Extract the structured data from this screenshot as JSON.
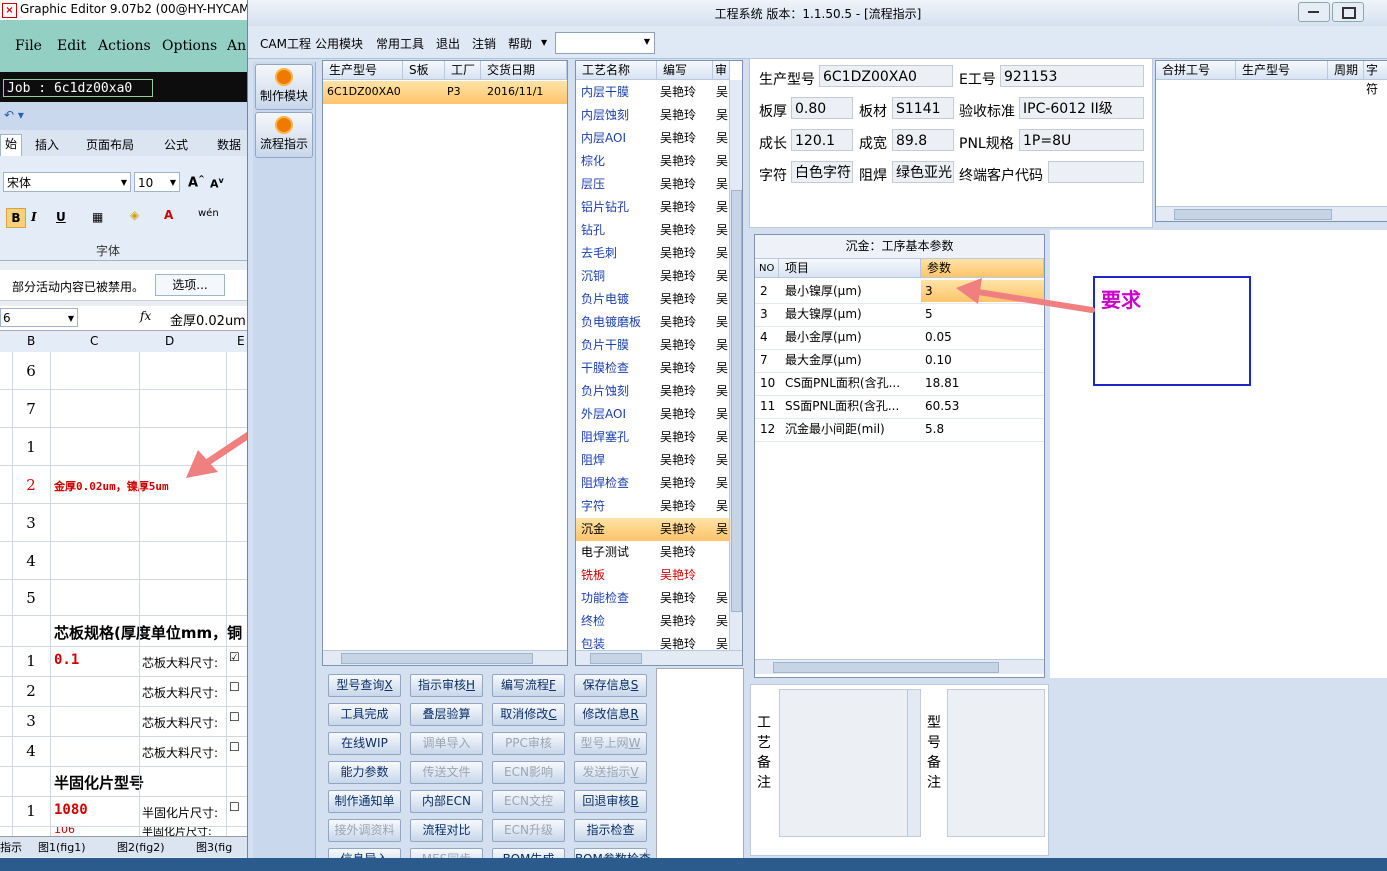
{
  "left_app": {
    "title": "Graphic Editor 9.07b2 (00@HY-HYCAM",
    "menu": [
      "File",
      "Edit",
      "Actions",
      "Options",
      "An"
    ],
    "job": "Job :  6c1dz00xa0"
  },
  "excel": {
    "ribbon_tabs": [
      "始",
      "插入",
      "页面布局",
      "公式",
      "数据"
    ],
    "font_name": "宋体",
    "font_size": "10",
    "font_group_label": "字体",
    "security_warning": "部分活动内容已被禁用。",
    "options_button": "选项...",
    "name_box": "6",
    "fx": "fx",
    "formula": "金厚0.02um",
    "col_headers": [
      "B",
      "C",
      "D",
      "E"
    ],
    "rows": [
      {
        "num": "6",
        "c": "",
        "d": ""
      },
      {
        "num": "7",
        "c": "",
        "d": ""
      },
      {
        "num": "1",
        "c": "",
        "d": ""
      },
      {
        "num": "2",
        "c": "金厚0.02um，镍厚5um",
        "d": ""
      },
      {
        "num": "3",
        "c": "",
        "d": ""
      },
      {
        "num": "4",
        "c": "",
        "d": ""
      },
      {
        "num": "5",
        "c": "",
        "d": ""
      },
      {
        "num": "",
        "c": "芯板规格(厚度单位mm，铜",
        "d": ""
      },
      {
        "num": "1",
        "c": "0.1",
        "d": "芯板大料尺寸:"
      },
      {
        "num": "2",
        "c": "",
        "d": "芯板大料尺寸:"
      },
      {
        "num": "3",
        "c": "",
        "d": "芯板大料尺寸:"
      },
      {
        "num": "4",
        "c": "",
        "d": "芯板大料尺寸:"
      },
      {
        "num": "",
        "c": "半固化片型号",
        "d": ""
      },
      {
        "num": "1",
        "c": "1080",
        "d": "半固化片尺寸:"
      },
      {
        "num": "",
        "c": "106",
        "d": "半固化片尺寸:"
      }
    ],
    "sheet_tabs": [
      "指示",
      "图1(fig1)",
      "图2(fig2)",
      "图3(fig"
    ]
  },
  "main": {
    "title": "工程系统    版本：1.1.50.5 - [流程指示]",
    "menu": [
      "CAM工程",
      "公用模块",
      "常用工具",
      "退出",
      "注销",
      "帮助"
    ],
    "nav": [
      "制作模块",
      "流程指示"
    ],
    "jobs_table": {
      "headers": [
        "生产型号",
        "S板",
        "工厂",
        "交货日期"
      ],
      "rows": [
        [
          "6C1DZ00XA0",
          "",
          "P3",
          "2016/11/1"
        ]
      ]
    },
    "process_table": {
      "headers": [
        "工艺名称",
        "编写",
        "审"
      ],
      "rows": [
        {
          "name": "内层干膜",
          "writer": "吴艳玲",
          "rev": "吴"
        },
        {
          "name": "内层蚀刻",
          "writer": "吴艳玲",
          "rev": "吴"
        },
        {
          "name": "内层AOI",
          "writer": "吴艳玲",
          "rev": "吴"
        },
        {
          "name": "棕化",
          "writer": "吴艳玲",
          "rev": "吴"
        },
        {
          "name": "层压",
          "writer": "吴艳玲",
          "rev": "吴"
        },
        {
          "name": "铝片钻孔",
          "writer": "吴艳玲",
          "rev": "吴"
        },
        {
          "name": "钻孔",
          "writer": "吴艳玲",
          "rev": "吴"
        },
        {
          "name": "去毛刺",
          "writer": "吴艳玲",
          "rev": "吴"
        },
        {
          "name": "沉铜",
          "writer": "吴艳玲",
          "rev": "吴"
        },
        {
          "name": "负片电镀",
          "writer": "吴艳玲",
          "rev": "吴"
        },
        {
          "name": "负电镀磨板",
          "writer": "吴艳玲",
          "rev": "吴"
        },
        {
          "name": "负片干膜",
          "writer": "吴艳玲",
          "rev": "吴"
        },
        {
          "name": "干膜检查",
          "writer": "吴艳玲",
          "rev": "吴"
        },
        {
          "name": "负片蚀刻",
          "writer": "吴艳玲",
          "rev": "吴"
        },
        {
          "name": "外层AOI",
          "writer": "吴艳玲",
          "rev": "吴"
        },
        {
          "name": "阻焊塞孔",
          "writer": "吴艳玲",
          "rev": "吴"
        },
        {
          "name": "阻焊",
          "writer": "吴艳玲",
          "rev": "吴"
        },
        {
          "name": "阻焊检查",
          "writer": "吴艳玲",
          "rev": "吴"
        },
        {
          "name": "字符",
          "writer": "吴艳玲",
          "rev": "吴"
        },
        {
          "name": "沉金",
          "writer": "吴艳玲",
          "rev": "吴"
        },
        {
          "name": "电子测试",
          "writer": "吴艳玲",
          "rev": ""
        },
        {
          "name": "铣板",
          "writer": "吴艳玲",
          "rev": ""
        },
        {
          "name": "功能检查",
          "writer": "吴艳玲",
          "rev": "吴"
        },
        {
          "name": "终检",
          "writer": "吴艳玲",
          "rev": "吴"
        },
        {
          "name": "包装",
          "writer": "吴艳玲",
          "rev": "吴"
        }
      ]
    },
    "buttons": [
      {
        "label": "型号查询",
        "key": "X",
        "enabled": true
      },
      {
        "label": "指示审核",
        "key": "H",
        "enabled": true
      },
      {
        "label": "编写流程",
        "key": "F",
        "enabled": true
      },
      {
        "label": "保存信息",
        "key": "S",
        "enabled": true
      },
      {
        "label": "工具完成",
        "key": "",
        "enabled": true
      },
      {
        "label": "叠层验算",
        "key": "",
        "enabled": true
      },
      {
        "label": "取消修改",
        "key": "C",
        "enabled": true
      },
      {
        "label": "修改信息",
        "key": "R",
        "enabled": true
      },
      {
        "label": "在线WIP",
        "key": "",
        "enabled": true
      },
      {
        "label": "调单导入",
        "key": "",
        "enabled": false
      },
      {
        "label": "PPC审核",
        "key": "",
        "enabled": false
      },
      {
        "label": "型号上网",
        "key": "W",
        "enabled": false
      },
      {
        "label": "能力参数",
        "key": "",
        "enabled": true
      },
      {
        "label": "传送文件",
        "key": "",
        "enabled": false
      },
      {
        "label": "ECN影响",
        "key": "",
        "enabled": false
      },
      {
        "label": "发送指示",
        "key": "V",
        "enabled": false
      },
      {
        "label": "制作通知单",
        "key": "",
        "enabled": true
      },
      {
        "label": "内部ECN",
        "key": "",
        "enabled": true
      },
      {
        "label": "ECN文控",
        "key": "",
        "enabled": false
      },
      {
        "label": "回退审核",
        "key": "B",
        "enabled": true
      },
      {
        "label": "接外调资料",
        "key": "",
        "enabled": false
      },
      {
        "label": "流程对比",
        "key": "",
        "enabled": true
      },
      {
        "label": "ECN升级",
        "key": "",
        "enabled": false
      },
      {
        "label": "指示检查",
        "key": "",
        "enabled": true
      },
      {
        "label": "信息导入",
        "key": "",
        "enabled": true
      },
      {
        "label": "MES同步",
        "key": "",
        "enabled": false
      },
      {
        "label": "BOM生成",
        "key": "",
        "enabled": true
      },
      {
        "label": "BOM参数检查",
        "key": "",
        "enabled": true
      }
    ],
    "info": {
      "model_label": "生产型号",
      "model": "6C1DZ00XA0",
      "eno_label": "E工号",
      "eno": "921153",
      "thick_label": "板厚",
      "thick": "0.80",
      "mat_label": "板材",
      "mat": "S1141",
      "std_label": "验收标准",
      "std": "IPC-6012 II级",
      "len_label": "成长",
      "len": "120.1",
      "wid_label": "成宽",
      "wid": "89.8",
      "pnl_label": "PNL规格",
      "pnl": "1P=8U",
      "char_label": "字符",
      "char": "白色字符",
      "mask_label": "阻焊",
      "mask": "绿色亚光",
      "cust_label": "终端客户代码",
      "cust": ""
    },
    "merge_table": {
      "headers": [
        "合拼工号",
        "生产型号",
        "周期",
        "字符"
      ]
    },
    "param_table": {
      "title": "沉金：工序基本参数",
      "headers": [
        "NO",
        "项目",
        "参数"
      ],
      "rows": [
        {
          "no": "2",
          "item": "最小镍厚(μm)",
          "value": "3"
        },
        {
          "no": "3",
          "item": "最大镍厚(μm)",
          "value": "5"
        },
        {
          "no": "4",
          "item": "最小金厚(μm)",
          "value": "0.05"
        },
        {
          "no": "7",
          "item": "最大金厚(μm)",
          "value": "0.10"
        },
        {
          "no": "10",
          "item": "CS面PNL面积(含孔...",
          "value": "18.81"
        },
        {
          "no": "11",
          "item": "SS面PNL面积(含孔...",
          "value": "60.53"
        },
        {
          "no": "12",
          "item": "沉金最小间距(mil)",
          "value": "5.8"
        }
      ]
    },
    "remarks": {
      "process_label": "工艺备注",
      "model_label": "型号备注"
    },
    "annotation": "要求"
  },
  "colors": {
    "highlight": "#ffc46b",
    "annotation_text": "#cc00cc",
    "annotation_border": "#1d27c8",
    "arrow": "#f08080",
    "red_text": "#d00000"
  }
}
